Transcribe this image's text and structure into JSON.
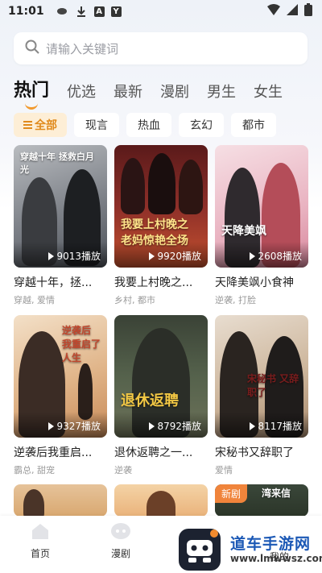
{
  "status": {
    "time": "11:01"
  },
  "search": {
    "placeholder": "请输入关键词"
  },
  "tabs": [
    {
      "label": "热门",
      "active": true
    },
    {
      "label": "优选"
    },
    {
      "label": "最新"
    },
    {
      "label": "漫剧"
    },
    {
      "label": "男生"
    },
    {
      "label": "女生"
    }
  ],
  "chips": [
    {
      "label": "全部",
      "active": true
    },
    {
      "label": "现言"
    },
    {
      "label": "热血"
    },
    {
      "label": "玄幻"
    },
    {
      "label": "都市"
    }
  ],
  "dramas": [
    {
      "title": "穿越十年，拯...",
      "tags": "穿越, 爱情",
      "plays": "9013播放",
      "poster_text": "穿越十年 拯救白月光",
      "color": "#8b8e93"
    },
    {
      "title": "我要上村晚之...",
      "tags": "乡村, 都市",
      "plays": "9920播放",
      "poster_text": "我要上村晚之 老妈惊艳全场",
      "color": "#7a2a27"
    },
    {
      "title": "天降美飒小食神",
      "tags": "逆袭, 打脸",
      "plays": "2608播放",
      "poster_text": "天降美飒",
      "color": "#e5b8c3"
    },
    {
      "title": "逆袭后我重启...",
      "tags": "霸总, 甜宠",
      "plays": "9327播放",
      "poster_text": "逆袭后 我重启了人生",
      "color": "#d9a978"
    },
    {
      "title": "退休返聘之一...",
      "tags": "逆袭",
      "plays": "8792播放",
      "poster_text": "退休返聘",
      "color": "#4e5b45"
    },
    {
      "title": "宋秘书又辞职了",
      "tags": "爱情",
      "plays": "8117播放",
      "poster_text": "宋秘书 又辞职了",
      "color": "#c9b39a"
    }
  ],
  "partial_cards": [
    {
      "badge": "",
      "color": "#e9c89e"
    },
    {
      "badge": "",
      "color": "#f0c28f"
    },
    {
      "badge": "新剧",
      "poster_text": "湾来信",
      "color": "#3d4a3a"
    }
  ],
  "bottom_nav": [
    {
      "label": "首页",
      "icon": "home-icon"
    },
    {
      "label": "漫剧",
      "icon": "comic-icon"
    },
    {
      "label": "",
      "icon": "app-icon"
    },
    {
      "label": "我的",
      "icon": "profile-icon"
    }
  ],
  "watermark": {
    "site_name": "道车手游网",
    "url": "www.lmwwsz.com"
  }
}
